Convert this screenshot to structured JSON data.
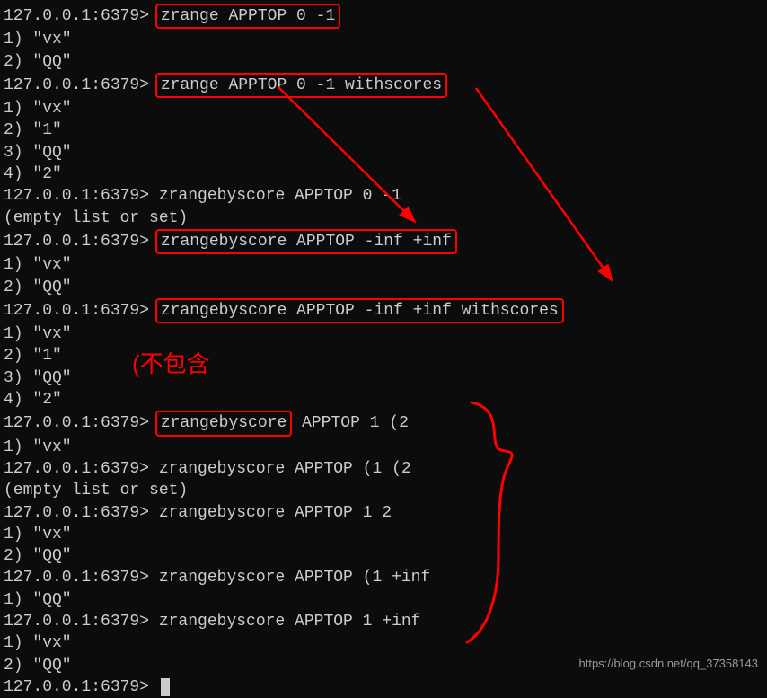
{
  "prompt": "127.0.0.1:6379>",
  "lines": [
    {
      "prompt": true,
      "cmd": "zrange APPTOP 0 -1",
      "boxed": true
    },
    {
      "text": "1) \"vx\""
    },
    {
      "text": "2) \"QQ\""
    },
    {
      "prompt": true,
      "cmd": "zrange APPTOP 0 -1 withscores",
      "boxed": true
    },
    {
      "text": "1) \"vx\""
    },
    {
      "text": "2) \"1\""
    },
    {
      "text": "3) \"QQ\""
    },
    {
      "text": "4) \"2\""
    },
    {
      "prompt": true,
      "cmd": "zrangebyscore APPTOP 0 -1",
      "boxed": false
    },
    {
      "text": "(empty list or set)"
    },
    {
      "prompt": true,
      "cmd": "zrangebyscore APPTOP -inf +inf",
      "boxed": true
    },
    {
      "text": "1) \"vx\""
    },
    {
      "text": "2) \"QQ\""
    },
    {
      "prompt": true,
      "cmd": "zrangebyscore APPTOP -inf +inf withscores",
      "boxed": true
    },
    {
      "text": "1) \"vx\""
    },
    {
      "text": "2) \"1\""
    },
    {
      "text": "3) \"QQ\""
    },
    {
      "text": "4) \"2\""
    },
    {
      "prompt": true,
      "cmd_prefix": "zrangebyscore",
      "cmd_suffix": " APPTOP 1 (2",
      "partial_box": true
    },
    {
      "text": "1) \"vx\""
    },
    {
      "prompt": true,
      "cmd": "zrangebyscore APPTOP (1 (2",
      "boxed": false
    },
    {
      "text": "(empty list or set)"
    },
    {
      "prompt": true,
      "cmd": "zrangebyscore APPTOP 1 2",
      "boxed": false
    },
    {
      "text": "1) \"vx\""
    },
    {
      "text": "2) \"QQ\""
    },
    {
      "prompt": true,
      "cmd": "zrangebyscore APPTOP (1 +inf",
      "boxed": false
    },
    {
      "text": "1) \"QQ\""
    },
    {
      "prompt": true,
      "cmd": "zrangebyscore APPTOP 1 +inf",
      "boxed": false
    },
    {
      "text": "1) \"vx\""
    },
    {
      "text": "2) \"QQ\""
    },
    {
      "prompt": true,
      "cmd": "",
      "cursor": true
    }
  ],
  "annotation_text": "(不包含",
  "watermark": "https://blog.csdn.net/qq_37358143"
}
